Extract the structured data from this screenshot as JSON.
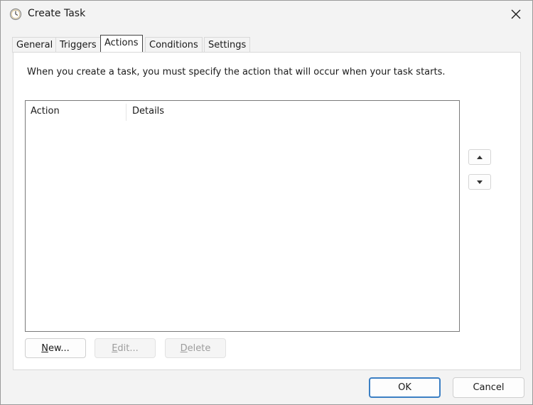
{
  "window": {
    "title": "Create Task"
  },
  "tabs": [
    {
      "label": "General"
    },
    {
      "label": "Triggers"
    },
    {
      "label": "Actions"
    },
    {
      "label": "Conditions"
    },
    {
      "label": "Settings"
    }
  ],
  "actions_panel": {
    "description": "When you create a task, you must specify the action that will occur when your task starts.",
    "columns": [
      "Action",
      "Details"
    ],
    "rows": []
  },
  "buttons": {
    "new": {
      "mnemonic": "N",
      "rest": "ew..."
    },
    "edit": {
      "mnemonic": "E",
      "rest": "dit..."
    },
    "delete": {
      "mnemonic": "D",
      "rest": "elete"
    },
    "ok": "OK",
    "cancel": "Cancel"
  },
  "icons": {
    "title": "task-scheduler-clock-icon",
    "close": "close-icon",
    "up": "move-up-icon",
    "down": "move-down-icon"
  }
}
